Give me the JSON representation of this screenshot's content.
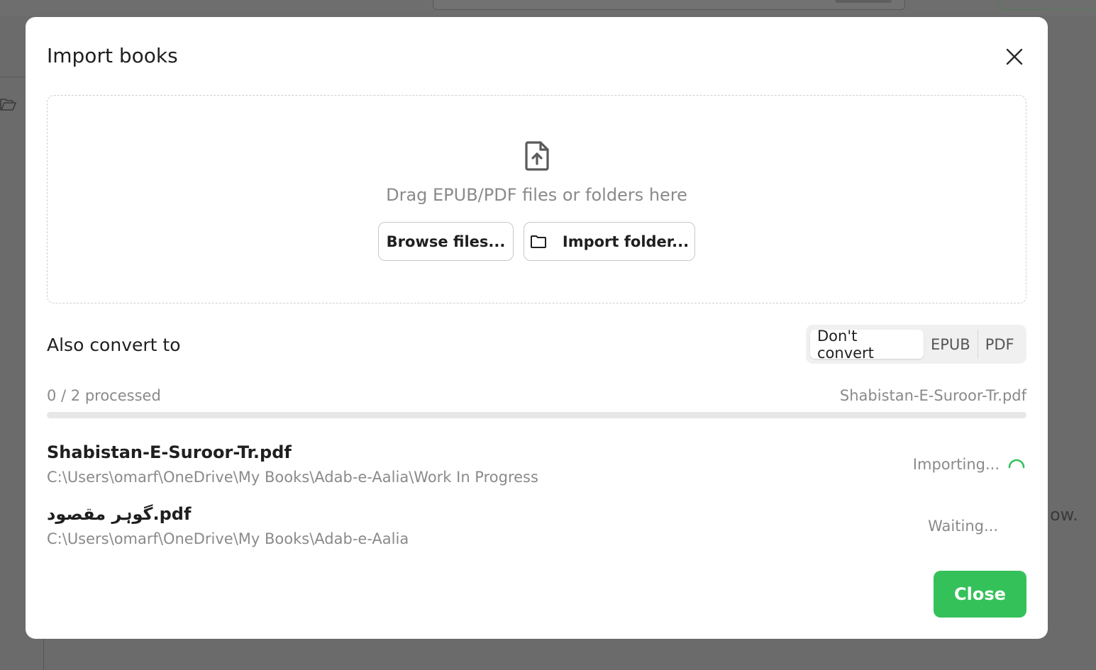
{
  "modal": {
    "title": "Import books",
    "dropzone": {
      "text": "Drag EPUB/PDF files or folders here",
      "browse_label": "Browse files...",
      "folder_label": "Import folder..."
    },
    "convert": {
      "label": "Also convert to",
      "options": [
        "Don't convert",
        "EPUB",
        "PDF"
      ],
      "selected": "Don't convert"
    },
    "progress": {
      "processed_text": "0 / 2 processed",
      "current_file": "Shabistan-E-Suroor-Tr.pdf",
      "fraction": 0
    },
    "files": [
      {
        "name": "Shabistan-E-Suroor-Tr.pdf",
        "path": "C:\\Users\\omarf\\OneDrive\\My Books\\Adab-e-Aalia\\Work In Progress",
        "status": "Importing..."
      },
      {
        "name": "گوہر مقصود.pdf",
        "path": "C:\\Users\\omarf\\OneDrive\\My Books\\Adab-e-Aalia",
        "status": "Waiting..."
      }
    ],
    "close_label": "Close"
  },
  "background": {
    "partial_text": "ow."
  },
  "colors": {
    "accent": "#34c15a",
    "muted_text": "#8a8a8a",
    "overlay": "#6b6b6b"
  },
  "icons": {
    "close": "close-icon",
    "upload": "file-upload-icon",
    "folder": "folder-icon",
    "spinner": "spinner-icon"
  }
}
